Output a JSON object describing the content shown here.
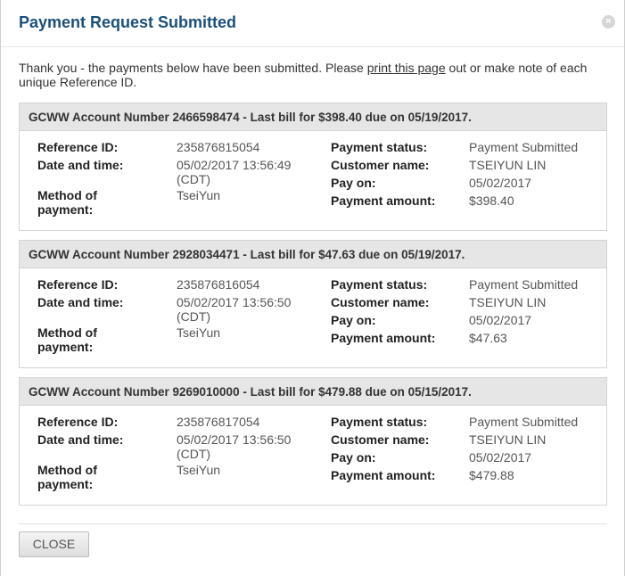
{
  "dialog": {
    "title": "Payment Request Submitted",
    "close_glyph": "×",
    "intro_before": "Thank you - the payments below have been submitted. Please ",
    "intro_link": "print this page",
    "intro_after": " out or make note of each unique Reference ID."
  },
  "labels": {
    "reference_id": "Reference ID:",
    "date_time": "Date and time:",
    "method": "Method of payment:",
    "status": "Payment status:",
    "customer": "Customer name:",
    "pay_on": "Pay on:",
    "amount": "Payment amount:"
  },
  "payments": [
    {
      "header": "GCWW Account Number 2466598474 - Last bill for $398.40 due on 05/19/2017.",
      "reference_id": "235876815054",
      "date_time": "05/02/2017 13:56:49 (CDT)",
      "method": "TseiYun",
      "status": "Payment Submitted",
      "customer": "TSEIYUN LIN",
      "pay_on": "05/02/2017",
      "amount": "$398.40"
    },
    {
      "header": "GCWW Account Number 2928034471 - Last bill for $47.63 due on 05/19/2017.",
      "reference_id": "235876816054",
      "date_time": "05/02/2017 13:56:50 (CDT)",
      "method": "TseiYun",
      "status": "Payment Submitted",
      "customer": "TSEIYUN LIN",
      "pay_on": "05/02/2017",
      "amount": "$47.63"
    },
    {
      "header": "GCWW Account Number 9269010000 - Last bill for $479.88 due on 05/15/2017.",
      "reference_id": "235876817054",
      "date_time": "05/02/2017 13:56:50 (CDT)",
      "method": "TseiYun",
      "status": "Payment Submitted",
      "customer": "TSEIYUN LIN",
      "pay_on": "05/02/2017",
      "amount": "$479.88"
    }
  ],
  "footer": {
    "close_label": "CLOSE"
  },
  "colors": {
    "title": "#1b4f7a",
    "panel_header_bg": "#e6e6e6"
  },
  "icons": {
    "dialog_close": "close-icon"
  }
}
